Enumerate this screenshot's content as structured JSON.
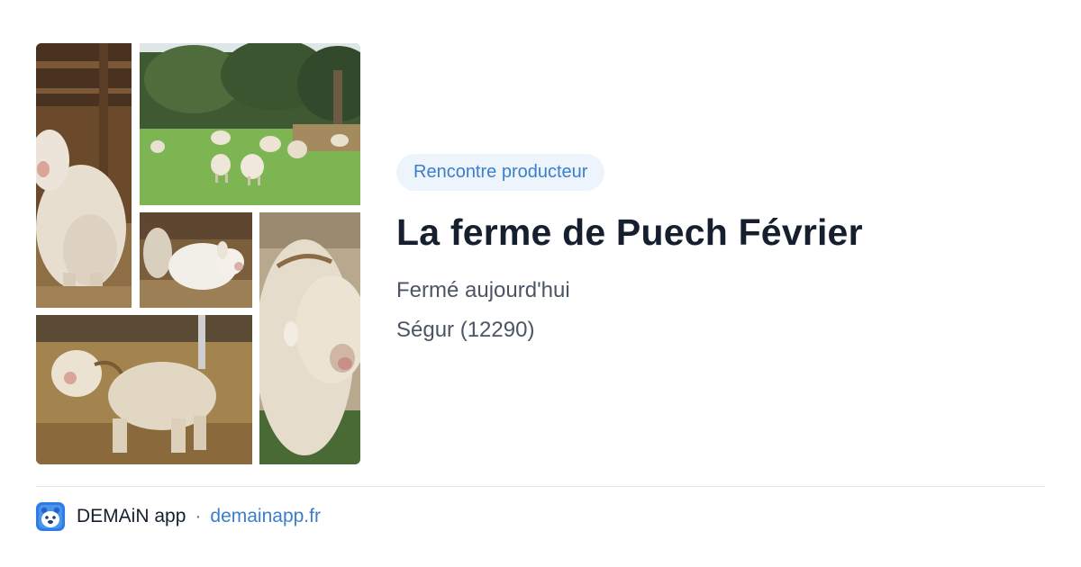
{
  "collage": {
    "photos": [
      {
        "icon": "angora-goat-barn-photo"
      },
      {
        "icon": "goats-in-meadow-photo"
      },
      {
        "icon": "baby-goat-photo"
      },
      {
        "icon": "goat-closeup-photo"
      },
      {
        "icon": "angora-goat-straw-photo"
      }
    ]
  },
  "badge": "Rencontre producteur",
  "title": "La ferme de Puech Février",
  "status": "Fermé aujourd'hui",
  "location": "Ségur (12290)",
  "footer": {
    "app_icon": "demain-app-icon",
    "app_name": "DEMAiN app",
    "separator": "·",
    "url": "demainapp.fr"
  },
  "colors": {
    "accent": "#3b7fcb",
    "badge_bg": "#edf4fc",
    "title": "#161f2e",
    "muted": "#4b5563",
    "divider": "#dde3ea"
  }
}
